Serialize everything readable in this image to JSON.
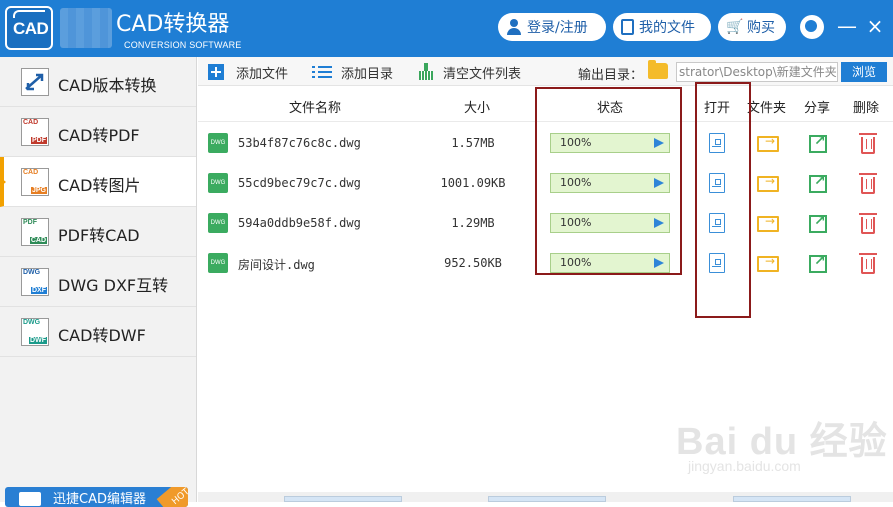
{
  "app": {
    "logo_text": "CAD",
    "title": "CAD转换器",
    "subtitle": "CONVERSION SOFTWARE",
    "login_label": "登录/注册",
    "my_files_label": "我的文件",
    "buy_label": "购买",
    "minimize": "—",
    "close": "×"
  },
  "sidebar": {
    "items": [
      {
        "label": "CAD版本转换",
        "icon": "cad-version-icon",
        "badge_top": "",
        "badge_bottom": ""
      },
      {
        "label": "CAD转PDF",
        "icon": "cad-to-pdf-icon",
        "badge_top": "CAD",
        "badge_bottom": "PDF"
      },
      {
        "label": "CAD转图片",
        "icon": "cad-to-image-icon",
        "badge_top": "CAD",
        "badge_bottom": "JPG"
      },
      {
        "label": "PDF转CAD",
        "icon": "pdf-to-cad-icon",
        "badge_top": "PDF",
        "badge_bottom": "CAD"
      },
      {
        "label": "DWG DXF互转",
        "icon": "dwg-dxf-icon",
        "badge_top": "DWG",
        "badge_bottom": "DXF"
      },
      {
        "label": "CAD转DWF",
        "icon": "cad-to-dwf-icon",
        "badge_top": "DWG",
        "badge_bottom": "DWF"
      }
    ],
    "active_index": 2,
    "promo_text": "迅捷CAD编辑器",
    "promo_badge": "HOT"
  },
  "toolbar": {
    "add_file": "添加文件",
    "add_dir": "添加目录",
    "clear_list": "清空文件列表",
    "output_label": "输出目录：",
    "output_path": "strator\\Desktop\\新建文件夹",
    "browse": "浏览"
  },
  "table": {
    "headers": {
      "name": "文件名称",
      "size": "大小",
      "status": "状态",
      "open": "打开",
      "folder": "文件夹",
      "share": "分享",
      "delete": "删除"
    },
    "file_icon_label": "DWG",
    "rows": [
      {
        "name": "53b4f87c76c8c.dwg",
        "size": "1.57MB",
        "status": "100%",
        "progress": 1.0
      },
      {
        "name": "55cd9bec79c7c.dwg",
        "size": "1001.09KB",
        "status": "100%",
        "progress": 1.0
      },
      {
        "name": "594a0ddb9e58f.dwg",
        "size": "1.29MB",
        "status": "100%",
        "progress": 1.0
      },
      {
        "name": "房间设计.dwg",
        "size": "952.50KB",
        "status": "100%",
        "progress": 1.0
      }
    ]
  },
  "watermark": {
    "main": "Bai du 经验",
    "sub": "jingyan.baidu.com"
  },
  "colors": {
    "brand": "#1f7ed4",
    "active_accent": "#f2a100",
    "progress_fill": "#e3f5d0",
    "highlight_box": "#8b1a1a"
  }
}
